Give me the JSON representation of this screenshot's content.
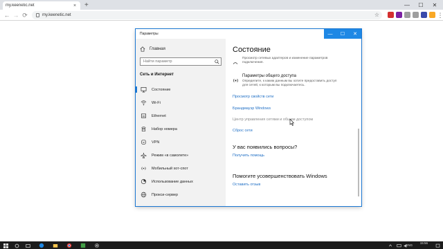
{
  "browser": {
    "tab_title": "my.keenetic.net",
    "tab_close": "×",
    "new_tab": "+",
    "url": "my.keenetic.net",
    "extension_colors": [
      "#d32f2f",
      "#7b1fa2",
      "#9e9e9e",
      "#9e9e9e",
      "#3949ab",
      "#f9a825"
    ]
  },
  "window": {
    "title": "Параметры",
    "minimize": "—",
    "maximize": "☐",
    "close": "✕",
    "accent_color": "#1976d2"
  },
  "sidebar": {
    "home_label": "Главная",
    "search_placeholder": "Найти параметр",
    "section_title": "Сеть и Интернет",
    "items": [
      {
        "label": "Состояние",
        "icon": "status-icon",
        "active": true
      },
      {
        "label": "Wi-Fi",
        "icon": "wifi-icon",
        "active": false
      },
      {
        "label": "Ethernet",
        "icon": "ethernet-icon",
        "active": false
      },
      {
        "label": "Набор номера",
        "icon": "dialup-icon",
        "active": false
      },
      {
        "label": "VPN",
        "icon": "vpn-icon",
        "active": false
      },
      {
        "label": "Режим «в самолете»",
        "icon": "airplane-icon",
        "active": false
      },
      {
        "label": "Мобильный хот-спот",
        "icon": "hotspot-icon",
        "active": false
      },
      {
        "label": "Использование данных",
        "icon": "data-usage-icon",
        "active": false
      },
      {
        "label": "Прокси-сервер",
        "icon": "globe-icon",
        "active": false
      }
    ]
  },
  "content": {
    "title": "Состояние",
    "adapters_desc_1": "Просмотр сетевых адаптеров и изменение параметров",
    "adapters_desc_2": "подключения.",
    "sharing_title": "Параметры общего доступа",
    "sharing_desc_1": "Определите, к каким данным вы хотите предоставить доступ",
    "sharing_desc_2": "для сетей, к которым вы подключаетесь.",
    "links": [
      {
        "label": "Просмотр свойств сети",
        "enabled": true
      },
      {
        "label": "Брандмауэр Windows",
        "enabled": true
      },
      {
        "label": "Центр управления сетями и общим доступом",
        "enabled": false
      },
      {
        "label": "Сброс сети",
        "enabled": true
      }
    ],
    "questions_title": "У вас появились вопросы?",
    "help_link": "Получить помощь",
    "improve_title": "Помогите усовершенствовать Windows",
    "feedback_link": "Оставить отзыв"
  },
  "taskbar": {
    "time": "15:56",
    "lang": "ENG",
    "app_icons": [
      "start-icon",
      "search-icon",
      "task-view-icon",
      "edge-icon",
      "explorer-icon",
      "chrome-icon",
      "media-icon",
      "settings-icon"
    ]
  }
}
